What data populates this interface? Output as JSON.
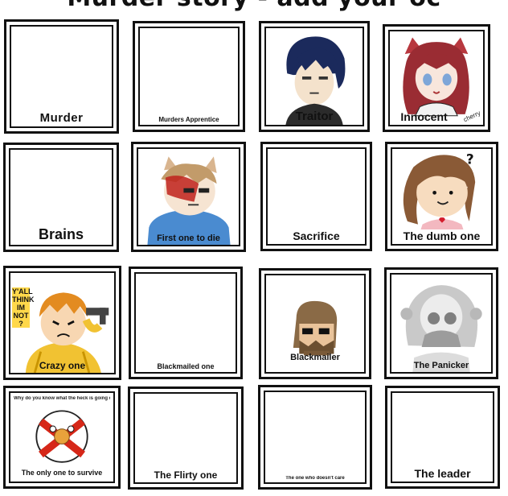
{
  "title": "Murder story - add your oc",
  "cells": [
    {
      "label": "Murder"
    },
    {
      "label": "Murders Apprentice"
    },
    {
      "label": "Traitor"
    },
    {
      "label": "Innocent",
      "signature": "cherry"
    },
    {
      "label": "Brains"
    },
    {
      "label": "First one to die"
    },
    {
      "label": "Sacrifice"
    },
    {
      "label": "The dumb one"
    },
    {
      "label": "Crazy one",
      "speech": "Y'ALL THINK IM NOT ?"
    },
    {
      "label": "Blackmailed one"
    },
    {
      "label": "Blackmailer"
    },
    {
      "label": "The Panicker"
    },
    {
      "label": "The only one to survive",
      "note": "Why do you know what the heck is going on"
    },
    {
      "label": "The Flirty one"
    },
    {
      "label": "The one who doesn't care"
    },
    {
      "label": "The leader"
    }
  ]
}
